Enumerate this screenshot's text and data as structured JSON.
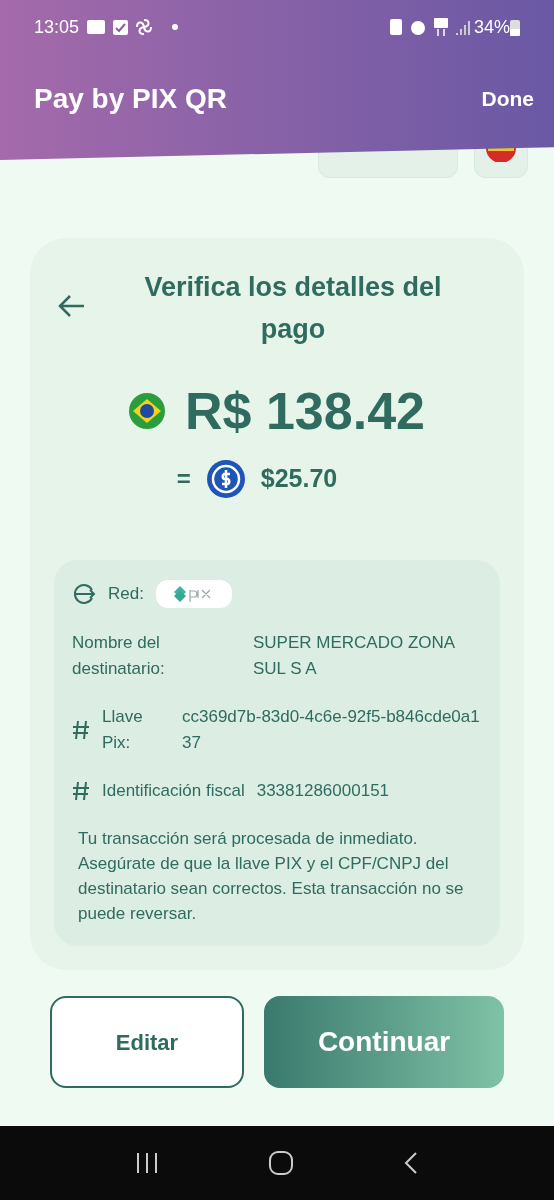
{
  "status_bar": {
    "time": "13:05",
    "battery": "34%"
  },
  "header": {
    "title": "Pay by PIX QR",
    "action": "Done"
  },
  "card": {
    "title": "Verifica los detalles del pago",
    "amount": "R$ 138.42",
    "equals": "=",
    "converted": "$25.70"
  },
  "details": {
    "network_label": "Red:",
    "rows": [
      {
        "kind": "plain",
        "label": "Nombre del destinatario:",
        "value": "SUPER MERCADO ZONA SUL S A"
      },
      {
        "kind": "hash",
        "label": "Llave Pix:",
        "value": "cc369d7b-83d0-4c6e-92f5-b846cde0a137"
      },
      {
        "kind": "hash_inline",
        "label": "Identificación fiscal",
        "value": "33381286000151"
      }
    ],
    "notice": "Tu transacción será procesada de inmediato. Asegúrate de que la llave PIX y el CPF/CNPJ del destinatario sean correctos. Esta transacción no se puede reversar."
  },
  "buttons": [
    {
      "kind": "outline",
      "label": "Editar"
    },
    {
      "kind": "primary",
      "label": "Continuar"
    }
  ]
}
